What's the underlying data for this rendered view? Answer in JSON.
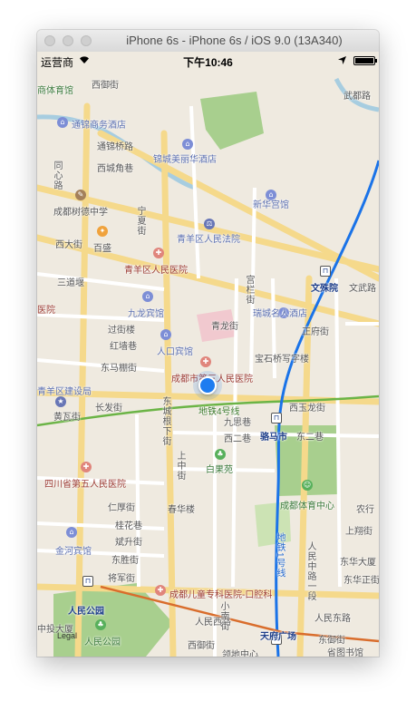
{
  "window": {
    "title": "iPhone 6s - iPhone 6s / iOS 9.0 (13A340)"
  },
  "status_bar": {
    "carrier": "运营商",
    "time": "下午10:46"
  },
  "map": {
    "legal": "Legal",
    "labels": {
      "sports_top": "商体育馆",
      "xiyu_street": "西御街",
      "wenwu_road": "武都路",
      "tongjin_hotel": "通锦商务酒店",
      "tongjin_bridge": "通锦桥路",
      "jinjiang_hotel": "锦城美丽华酒店",
      "xijie": "西城角巷",
      "tongxin_road": "同心路",
      "shudu_school": "成都树德中学",
      "xinhua_hall": "新华宫馆",
      "ningxia_street": "宁夏街",
      "baisheng": "百盛",
      "qingyang_court": "青羊区人民法院",
      "xida_street": "西大街",
      "qingyang_hospital": "青羊区人民医院",
      "wenshu_yuan": "文殊院",
      "wenwu_road2": "文武路",
      "sandaoyan": "三道堰",
      "jiulong_hotel": "九龙宾馆",
      "ruicheng_hotel": "瑞城名人酒店",
      "qinglong_street": "青龙街",
      "zhengfu_street": "正府街",
      "hospital_left": "医院",
      "renkou_hotel": "人口宾馆",
      "baoshiqiao_tower": "宝石桥写字楼",
      "guoye": "过街楼",
      "honglou": "红墙巷",
      "third_hospital": "成都市第三人民医院",
      "metro_line4": "地铁4号线",
      "xiyulong_street": "西玉龙街",
      "qingyang_construction": "青羊区建设局",
      "dongchengbao": "东马棚街",
      "changfa_street": "长发街",
      "jiusi_lane": "九思巷",
      "xierxiang": "西二巷",
      "luomashi": "骆马市",
      "dongerxiang": "东二巷",
      "huangxian": "黄瓦街",
      "baiguoyuan": "白果苑",
      "sichuan_fifth_hospital": "四川省第五人民医院",
      "chunhua_hotel": "春华楼",
      "renyang_street": "仁厚街",
      "tiyu_center": "成都体育中心",
      "nonglv": "农行",
      "guihua_lane": "桂花巷",
      "jinhe_hotel": "金河宾馆",
      "wuqi_street": "斌升街",
      "dongsheng_street": "东胜街",
      "jiangjun_street": "将军街",
      "shangxiang_street": "上翔街",
      "dongsheng_tower": "东华大厦",
      "dongbeizheng": "东华正街",
      "children_hospital": "成都儿童专科医院-口腔科",
      "renmin_park_top": "人民公园",
      "renmin_west": "人民西路",
      "renmin_east": "人民东路",
      "renmin_park": "人民公园",
      "tianfu_square": "天府广场",
      "zhongjiao": "中投大厦",
      "metro_line1": "地铁1号线",
      "dongyujie": "东御街",
      "xiyujie": "西御街",
      "shengtu": "省图书馆",
      "zhongxin": "领地中心",
      "xiaonancheng": "小南街",
      "dongchengbian": "东城根下街",
      "renmin_middle": "人民中路一段",
      "shangzhong_street": "上中街",
      "gongxi_street": "宫栏街"
    }
  }
}
